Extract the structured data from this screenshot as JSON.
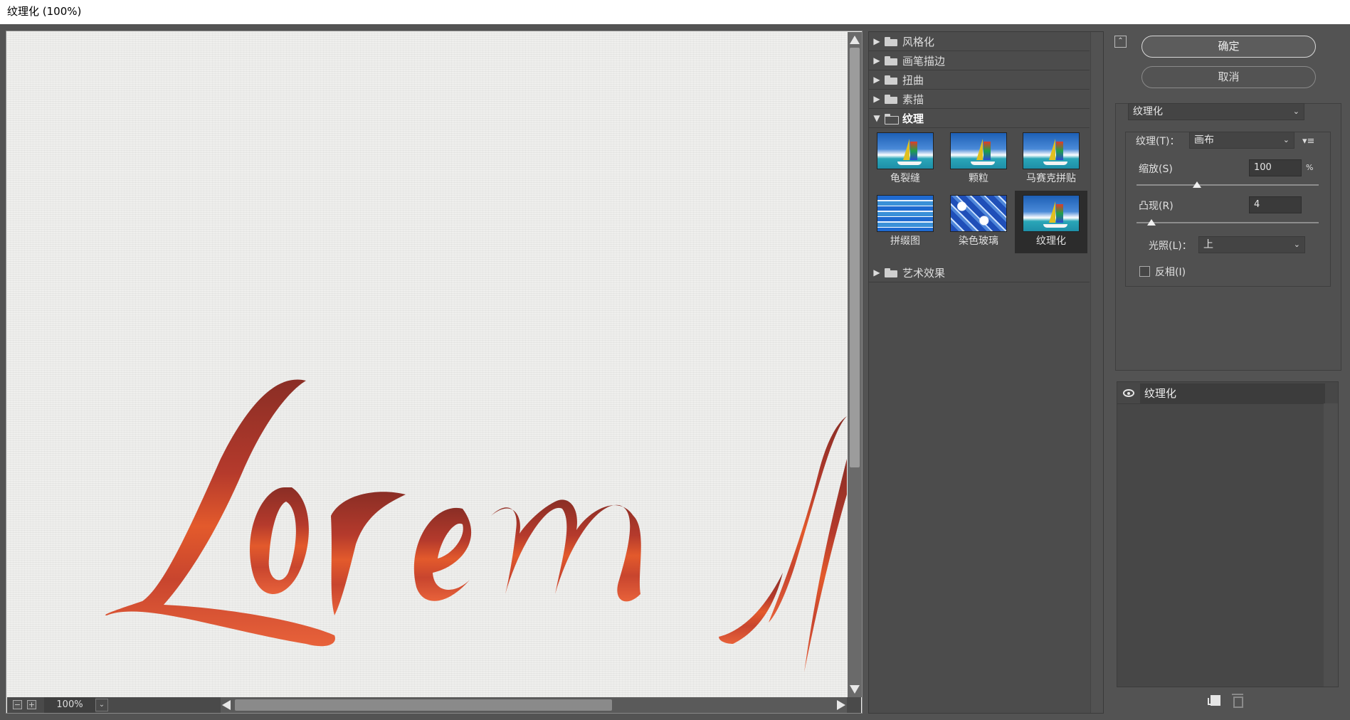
{
  "window": {
    "title": "纹理化 (100%)"
  },
  "preview": {
    "canvas_text": "Lorem",
    "zoom": "100%",
    "zoom_out": "−",
    "zoom_in": "+",
    "zoom_dropdown": "⌄"
  },
  "gallery": {
    "categories": [
      {
        "label": "风格化",
        "expanded": false
      },
      {
        "label": "画笔描边",
        "expanded": false
      },
      {
        "label": "扭曲",
        "expanded": false
      },
      {
        "label": "素描",
        "expanded": false
      },
      {
        "label": "纹理",
        "expanded": true
      },
      {
        "label": "艺术效果",
        "expanded": false
      }
    ],
    "texture_filters": [
      {
        "label": "龟裂缝",
        "selected": false
      },
      {
        "label": "颗粒",
        "selected": false
      },
      {
        "label": "马赛克拼贴",
        "selected": false
      },
      {
        "label": "拼缀图",
        "selected": false
      },
      {
        "label": "染色玻璃",
        "selected": false
      },
      {
        "label": "纹理化",
        "selected": true
      }
    ]
  },
  "buttons": {
    "ok": "确定",
    "cancel": "取消"
  },
  "settings": {
    "filter_select": "纹理化",
    "texture_label": "纹理(T)：",
    "texture_value": "画布",
    "scale_label": "缩放(S)",
    "scale_value": "100",
    "scale_unit": "%",
    "relief_label": "凸现(R)",
    "relief_value": "4",
    "light_label": "光照(L)：",
    "light_value": "上",
    "invert_label": "反相(I)",
    "invert_checked": false
  },
  "layers": [
    {
      "name": "纹理化",
      "visible": true
    }
  ],
  "colors": {
    "lettering": "#c8452e",
    "lettering_dark": "#8a2e25"
  }
}
